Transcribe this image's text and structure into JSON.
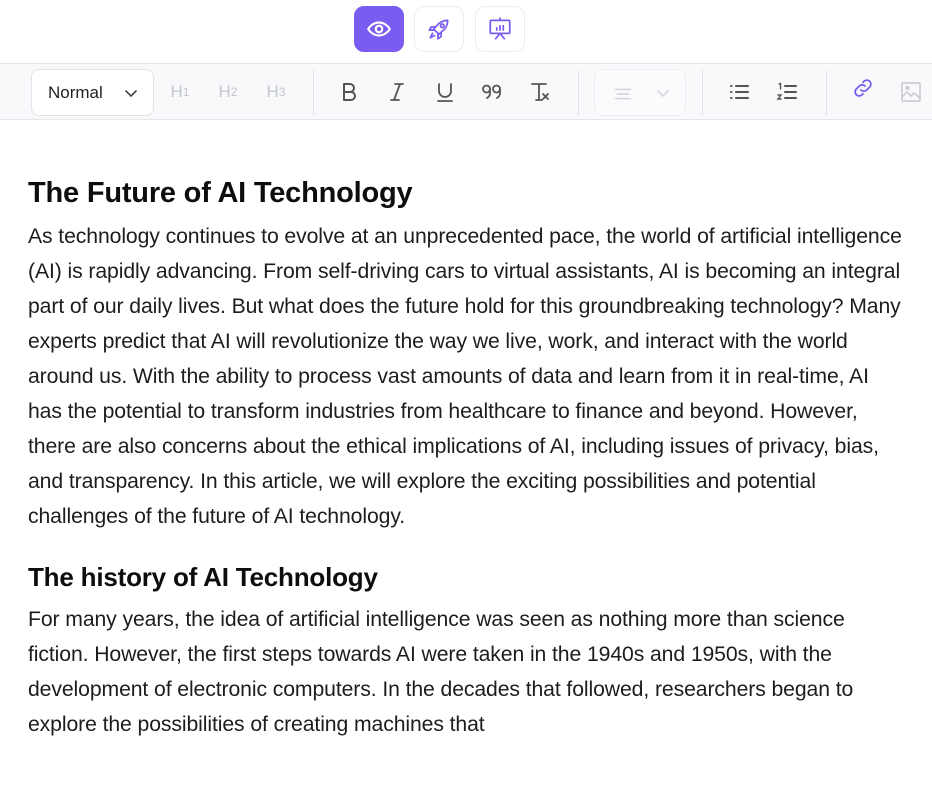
{
  "topbar": {
    "modes": [
      {
        "name": "preview",
        "icon": "eye-icon",
        "active": true
      },
      {
        "name": "launch",
        "icon": "rocket-icon",
        "active": false
      },
      {
        "name": "presentation",
        "icon": "presentation-chart-icon",
        "active": false
      }
    ],
    "accent_color": "#7b5cf0"
  },
  "toolbar": {
    "text_style": {
      "selected": "Normal"
    },
    "headings": [
      {
        "label": "H",
        "level": "1"
      },
      {
        "label": "H",
        "level": "2"
      },
      {
        "label": "H",
        "level": "3"
      }
    ],
    "format_buttons": [
      "bold",
      "italic",
      "underline",
      "blockquote",
      "clear-formatting"
    ],
    "align_select": {
      "icon": "align-icon"
    },
    "list_buttons": [
      "bullet-list",
      "ordered-list"
    ],
    "insert_buttons": [
      "link",
      "image"
    ]
  },
  "document": {
    "title": "The Future of AI Technology",
    "intro": "As technology continues to evolve at an unprecedented pace, the world of artificial intelligence (AI) is rapidly advancing. From self-driving cars to virtual assistants, AI is becoming an integral part of our daily lives. But what does the future hold for this groundbreaking technology? Many experts predict that AI will revolutionize the way we live, work, and interact with the world around us. With the ability to process vast amounts of data and learn from it in real-time, AI has the potential to transform industries from healthcare to finance and beyond. However, there are also concerns about the ethical implications of AI, including issues of privacy, bias, and transparency. In this article, we will explore the exciting possibilities and potential challenges of the future of AI technology.",
    "section_heading": "The history of AI Technology",
    "section_body": "For many years, the idea of artificial intelligence was seen as nothing more than science fiction. However, the first steps towards AI were taken in the 1940s and 1950s, with the development of electronic computers. In the decades that followed, researchers began to explore the possibilities of creating machines that"
  }
}
